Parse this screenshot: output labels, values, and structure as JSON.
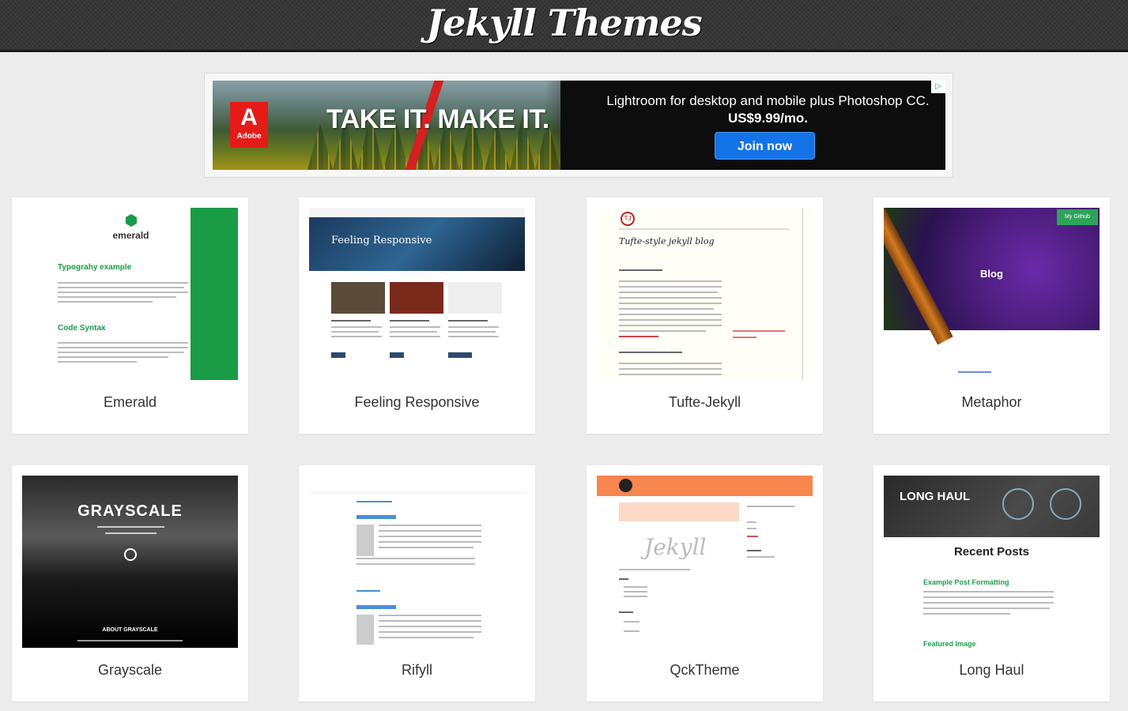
{
  "header": {
    "title": "Jekyll Themes"
  },
  "ad": {
    "brand": "Adobe",
    "brand_mark": "A",
    "slogan": "TAKE IT. MAKE IT.",
    "headline": "Lightroom for desktop and mobile plus Photoshop CC.",
    "price": "US$9.99/mo.",
    "cta": "Join now",
    "choices_icon": "adchoices-icon"
  },
  "themes": [
    {
      "name": "Emerald"
    },
    {
      "name": "Feeling Responsive"
    },
    {
      "name": "Tufte-Jekyll"
    },
    {
      "name": "Metaphor"
    },
    {
      "name": "Grayscale"
    },
    {
      "name": "Rifyll"
    },
    {
      "name": "QckTheme"
    },
    {
      "name": "Long Haul"
    }
  ],
  "thumbs": {
    "emerald": {
      "brand": "emerald",
      "h1": "Typograhy example",
      "h2": "Code Syntax"
    },
    "feeling": {
      "title": "Feeling Responsive"
    },
    "tufte": {
      "logo": "TJ",
      "title": "Tufte-style jekyll blog"
    },
    "metaphor": {
      "blog": "Blog",
      "badge": "My Github"
    },
    "grayscale": {
      "title": "GRAYSCALE",
      "about": "ABOUT GRAYSCALE"
    },
    "qck": {
      "logo": "Jekyll"
    },
    "longhaul": {
      "title": "LONG HAUL",
      "recent": "Recent Posts",
      "link1": "Example Post Formatting",
      "link2": "Featured Image"
    }
  },
  "colors": {
    "header_bg": "#363636",
    "accent_green": "#1a9b46",
    "cta_blue": "#1473e6",
    "adobe_red": "#e41b17"
  }
}
